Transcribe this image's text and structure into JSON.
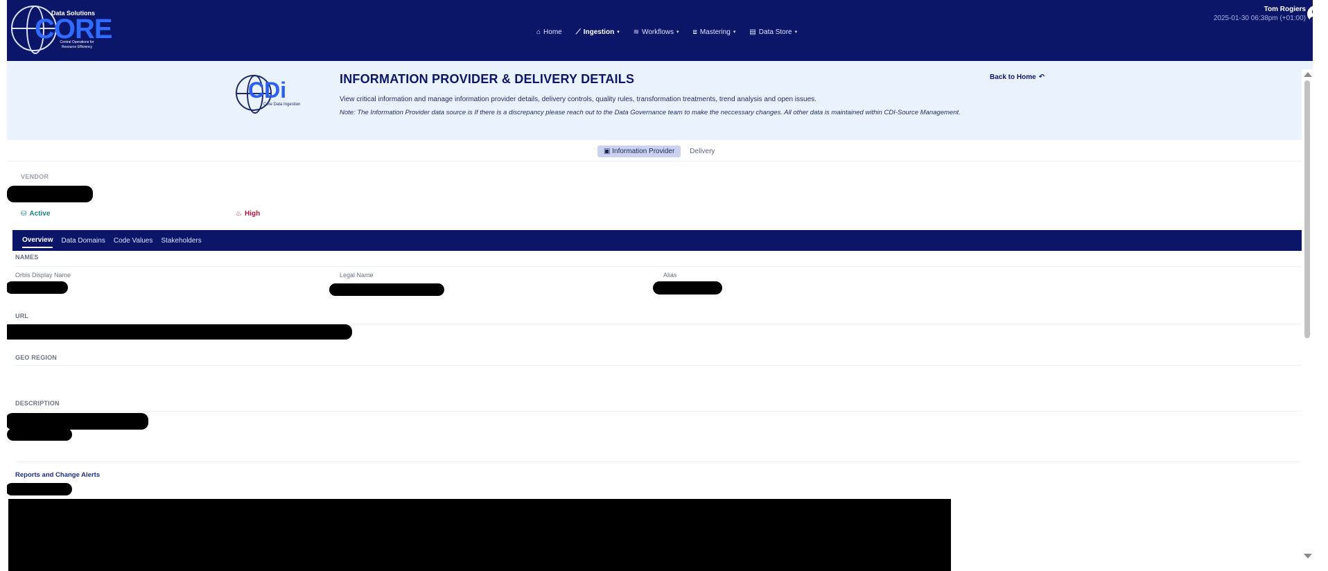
{
  "header": {
    "logo": {
      "brand": "CORE",
      "top": "Data Solutions",
      "tagline": "Central Operations for Resource Efficiency"
    },
    "nav": [
      {
        "label": "Home",
        "icon": "home-icon",
        "glyph": "⌂",
        "dropdown": false
      },
      {
        "label": "Ingestion",
        "icon": "ingestion-icon",
        "glyph": "⟋",
        "dropdown": true,
        "active": true
      },
      {
        "label": "Workflows",
        "icon": "workflows-icon",
        "glyph": "≋",
        "dropdown": true
      },
      {
        "label": "Mastering",
        "icon": "mastering-icon",
        "glyph": "⧈",
        "dropdown": true
      },
      {
        "label": "Data Store",
        "icon": "data-store-icon",
        "glyph": "▤",
        "dropdown": true
      }
    ],
    "user": {
      "name": "Tom Rogiers",
      "timestamp": "2025-01-30 06:38pm (+01:00)"
    }
  },
  "banner": {
    "logo": {
      "brand": "CDi",
      "subtitle": "Core Data Ingestion"
    },
    "title": "INFORMATION PROVIDER & DELIVERY DETAILS",
    "description": "View critical information and manage information provider details, delivery controls, quality rules, transformation treatments, trend analysis and open issues.",
    "note": "Note: The Information Provider data source is              If there is a discrepancy please reach out to the Data Governance team to make the neccessary changes. All other data is maintained within CDI-Source Management.",
    "back_label": "Back to Home"
  },
  "toggle": [
    "Information Provider",
    "Delivery"
  ],
  "vendor": {
    "label": "VENDOR",
    "status": "Active",
    "priority": "High"
  },
  "tabs": [
    "Overview",
    "Data Domains",
    "Code Values",
    "Stakeholders"
  ],
  "overview": {
    "names_label": "NAMES",
    "fields": [
      "Orbis Display Name",
      "Legal Name",
      "Alias"
    ],
    "url_label": "URL",
    "geo_label": "GEO REGION",
    "description_label": "DESCRIPTION",
    "reports_link": "Reports and Change Alerts"
  },
  "colors": {
    "header": "#0c1669",
    "banner": "#eaf3fd",
    "active": "#14847e",
    "high": "#c0123c"
  }
}
